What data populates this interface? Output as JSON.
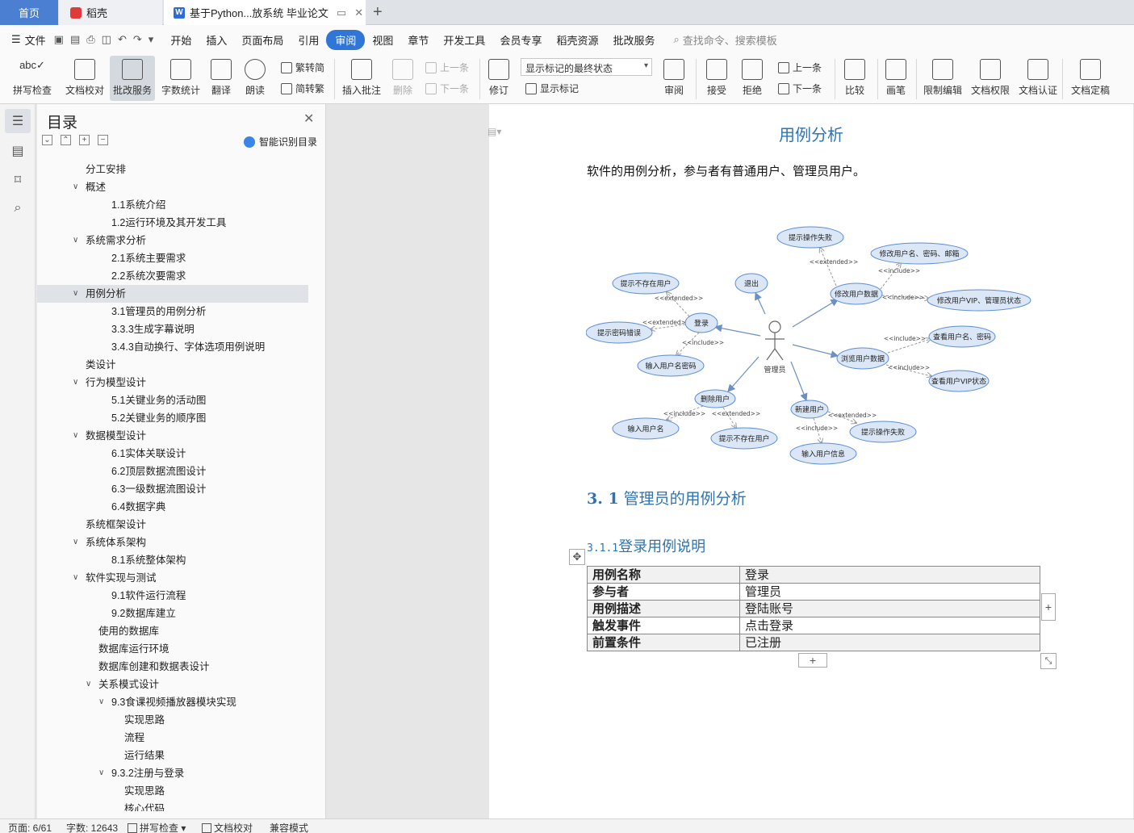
{
  "tabs": {
    "home": "首页",
    "daoke": "稻壳",
    "document": "基于Python...放系统 毕业论文"
  },
  "menu": {
    "file": "文件",
    "items": [
      "开始",
      "插入",
      "页面布局",
      "引用",
      "审阅",
      "视图",
      "章节",
      "开发工具",
      "会员专享",
      "稻壳资源",
      "批改服务"
    ],
    "active": "审阅",
    "search": "查找命令、搜索模板"
  },
  "ribbon": {
    "spell_check": "拼写检查",
    "doc_proof": "文档校对",
    "correction_service": "批改服务",
    "word_count": "字数统计",
    "translate": "翻译",
    "read_aloud": "朗读",
    "trad_to_simp": "繁转简",
    "simp_to_trad": "简转繁",
    "insert_comment": "插入批注",
    "delete": "删除",
    "prev_comment": "上一条",
    "next_comment": "下一条",
    "revise": "修订",
    "markup_state": "显示标记的最终状态",
    "show_markup": "显示标记",
    "review": "审阅",
    "accept": "接受",
    "reject": "拒绝",
    "prev_change": "上一条",
    "next_change": "下一条",
    "compare": "比较",
    "pen": "画笔",
    "restrict_edit": "限制编辑",
    "doc_rights": "文档权限",
    "doc_cert": "文档认证",
    "doc_finalize": "文档定稿"
  },
  "toc": {
    "title": "目录",
    "smart_button": "智能识别目录",
    "items": [
      {
        "label": "分工安排",
        "level": 1,
        "arrow": ""
      },
      {
        "label": "概述",
        "level": 1,
        "arrow": "v"
      },
      {
        "label": "1.1系统介绍",
        "level": 2,
        "arrow": ""
      },
      {
        "label": "1.2运行环境及其开发工具",
        "level": 2,
        "arrow": ""
      },
      {
        "label": "系统需求分析",
        "level": 1,
        "arrow": "v"
      },
      {
        "label": "2.1系统主要需求",
        "level": 2,
        "arrow": ""
      },
      {
        "label": "2.2系统次要需求",
        "level": 2,
        "arrow": ""
      },
      {
        "label": "用例分析",
        "level": 1,
        "arrow": "v",
        "selected": true
      },
      {
        "label": "3.1管理员的用例分析",
        "level": 2,
        "arrow": ""
      },
      {
        "label": "3.3.3生成字幕说明",
        "level": 2,
        "arrow": ""
      },
      {
        "label": "3.4.3自动换行、字体选项用例说明",
        "level": 2,
        "arrow": ""
      },
      {
        "label": "类设计",
        "level": 1,
        "arrow": ""
      },
      {
        "label": "行为模型设计",
        "level": 1,
        "arrow": "v"
      },
      {
        "label": "5.1关键业务的活动图",
        "level": 2,
        "arrow": ""
      },
      {
        "label": "5.2关键业务的顺序图",
        "level": 2,
        "arrow": ""
      },
      {
        "label": "数据模型设计",
        "level": 1,
        "arrow": "v"
      },
      {
        "label": "6.1实体关联设计",
        "level": 2,
        "arrow": ""
      },
      {
        "label": "6.2顶层数据流图设计",
        "level": 2,
        "arrow": ""
      },
      {
        "label": "6.3一级数据流图设计",
        "level": 2,
        "arrow": ""
      },
      {
        "label": "6.4数据字典",
        "level": 2,
        "arrow": ""
      },
      {
        "label": "系统框架设计",
        "level": 1,
        "arrow": ""
      },
      {
        "label": "系统体系架构",
        "level": 1,
        "arrow": "v"
      },
      {
        "label": "8.1系统整体架构",
        "level": 2,
        "arrow": ""
      },
      {
        "label": "软件实现与测试",
        "level": 1,
        "arrow": "v"
      },
      {
        "label": "9.1软件运行流程",
        "level": 2,
        "arrow": ""
      },
      {
        "label": "9.2数据库建立",
        "level": 2,
        "arrow": ""
      },
      {
        "label": "使用的数据库",
        "level": 1.5,
        "arrow": ""
      },
      {
        "label": "数据库运行环境",
        "level": 1.5,
        "arrow": ""
      },
      {
        "label": "数据库创建和数据表设计",
        "level": 1.5,
        "arrow": ""
      },
      {
        "label": "关系模式设计",
        "level": 1.5,
        "arrow": "v"
      },
      {
        "label": "9.3食课视频播放器模块实现",
        "level": 2,
        "arrow": "v"
      },
      {
        "label": "实现思路",
        "level": 3,
        "arrow": ""
      },
      {
        "label": "流程",
        "level": 3,
        "arrow": ""
      },
      {
        "label": "运行结果",
        "level": 3,
        "arrow": ""
      },
      {
        "label": "9.3.2注册与登录",
        "level": 2,
        "arrow": "v"
      },
      {
        "label": "实现思路",
        "level": 3,
        "arrow": ""
      },
      {
        "label": "核心代码",
        "level": 3,
        "arrow": ""
      }
    ]
  },
  "document": {
    "heading": "用例分析",
    "paragraph": "软件的用例分析，参与者有普通用户、管理员用户。",
    "diagram": {
      "actor": "管理员",
      "nodes": {
        "fail1": "提示操作失败",
        "modify_info": "修改用户名、密码、邮箱",
        "not_exist1": "提示不存在用户",
        "logout": "退出",
        "modify_data": "修改用户数据",
        "modify_vip": "修改用户VIP、管理员状态",
        "login": "登录",
        "pwd_error": "提示密码错误",
        "view_name": "查看用户名、密码",
        "browse": "浏览用户数据",
        "input_login": "输入用户名密码",
        "view_vip": "查看用户VIP状态",
        "delete_user": "删除用户",
        "new_user": "新建用户",
        "input_name": "输入用户名",
        "not_exist2": "提示不存在用户",
        "fail2": "提示操作失败",
        "input_info": "输入用户信息"
      },
      "labels": {
        "extended": "<<extended>>",
        "include": "<<include>>"
      }
    },
    "h2_num": "3. 1",
    "h2_text": "管理员的用例分析",
    "h3_num": "3.1.1",
    "h3_text": "登录用例说明",
    "table": [
      {
        "key": "用例名称",
        "value": "登录"
      },
      {
        "key": "参与者",
        "value": "管理员"
      },
      {
        "key": "用例描述",
        "value": "登陆账号"
      },
      {
        "key": "触发事件",
        "value": "点击登录"
      },
      {
        "key": "前置条件",
        "value": "已注册"
      }
    ]
  },
  "status": {
    "page": "页面: 6/61",
    "words": "字数: 12643",
    "spell": "拼写检查",
    "proof": "文档校对",
    "compat": "兼容模式"
  },
  "colors": {
    "accent": "#2f76d6",
    "heading": "#2e74b5",
    "ellipse_fill": "#dbe7f6",
    "ellipse_stroke": "#5b8dd6"
  }
}
